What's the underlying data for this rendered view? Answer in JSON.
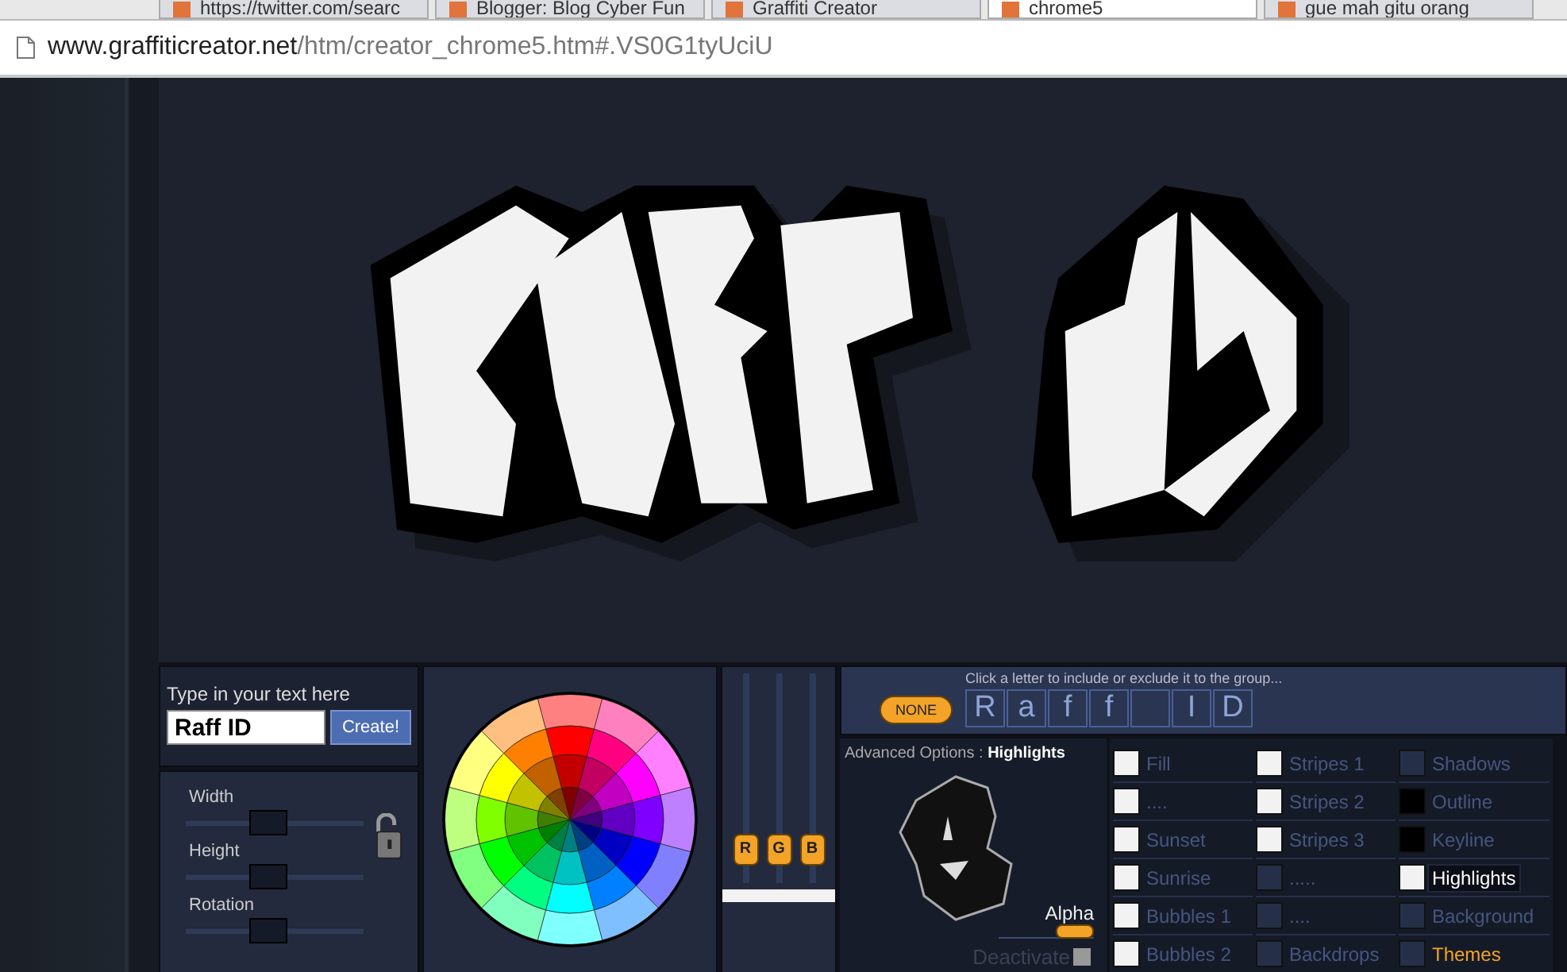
{
  "browser": {
    "tabs": [
      {
        "title": "https://twitter.com/searc",
        "selected": false
      },
      {
        "title": "Blogger: Blog Cyber Fun",
        "selected": false
      },
      {
        "title": "Graffiti Creator",
        "selected": false
      },
      {
        "title": "chrome5",
        "selected": true
      },
      {
        "title": "gue mah gitu orang",
        "selected": false
      }
    ],
    "address": {
      "host": "www.graffiticreator.net",
      "path": "/htm/creator_chrome5.htm#.VS0G1tyUciU"
    }
  },
  "text_panel": {
    "label": "Type in your text here",
    "value": "Raff ID",
    "button": "Create!"
  },
  "sliders": [
    {
      "label": "Width",
      "level": 0.45
    },
    {
      "label": "Height",
      "level": 0.45
    },
    {
      "label": "Rotation",
      "level": 0.45
    }
  ],
  "rgb_sliders": [
    {
      "label": "R",
      "level": 0.1
    },
    {
      "label": "G",
      "level": 0.1
    },
    {
      "label": "B",
      "level": 0.1
    }
  ],
  "letter_group": {
    "hint": "Click a letter to include or exclude it to the group...",
    "button": "NONE",
    "letters": [
      {
        "kind": "letter",
        "char": "R"
      },
      {
        "kind": "letter",
        "char": "a"
      },
      {
        "kind": "letter",
        "char": "f"
      },
      {
        "kind": "letter",
        "char": "f"
      },
      {
        "kind": "space"
      },
      {
        "kind": "letter",
        "char": "I"
      },
      {
        "kind": "letter",
        "char": "D"
      }
    ]
  },
  "advanced": {
    "label": "Advanced Options :",
    "current": "Highlights",
    "alpha_label": "Alpha",
    "alpha": {
      "level": 1.0
    },
    "deactivate": {
      "label": "Deactivate",
      "checked": false
    }
  },
  "options": [
    {
      "label": "Fill",
      "color": "#f2f2f2",
      "selected": false,
      "kind": "layer"
    },
    {
      "label": "Stripes 1",
      "color": "#f2f2f2",
      "selected": false,
      "kind": "layer"
    },
    {
      "label": "Shadows",
      "color": "#253048",
      "selected": false,
      "kind": "layer"
    },
    {
      "label": "....",
      "color": "#f2f2f2",
      "selected": false,
      "kind": "layer"
    },
    {
      "label": "Stripes 2",
      "color": "#f2f2f2",
      "selected": false,
      "kind": "layer"
    },
    {
      "label": "Outline",
      "color": "#000000",
      "selected": false,
      "kind": "layer"
    },
    {
      "label": "Sunset",
      "color": "#f2f2f2",
      "selected": false,
      "kind": "layer"
    },
    {
      "label": "Stripes 3",
      "color": "#f2f2f2",
      "selected": false,
      "kind": "layer"
    },
    {
      "label": "Keyline",
      "color": "#000000",
      "selected": false,
      "kind": "layer"
    },
    {
      "label": "Sunrise",
      "color": "#f2f2f2",
      "selected": false,
      "kind": "layer"
    },
    {
      "label": ".....",
      "color": "#253048",
      "selected": false,
      "kind": "layer"
    },
    {
      "label": "Highlights",
      "color": "#f2f2f2",
      "selected": true,
      "kind": "layer"
    },
    {
      "label": "Bubbles 1",
      "color": "#f2f2f2",
      "selected": false,
      "kind": "layer"
    },
    {
      "label": "....",
      "color": "#253048",
      "selected": false,
      "kind": "layer"
    },
    {
      "label": "Background",
      "color": "#253048",
      "selected": false,
      "kind": "layer"
    },
    {
      "label": "Bubbles 2",
      "color": "#f2f2f2",
      "selected": false,
      "kind": "layer"
    },
    {
      "label": "Backdrops",
      "color": "#253048",
      "selected": false,
      "kind": "layer"
    },
    {
      "label": "Themes",
      "color": "#253048",
      "selected": false,
      "kind": "themes"
    }
  ]
}
